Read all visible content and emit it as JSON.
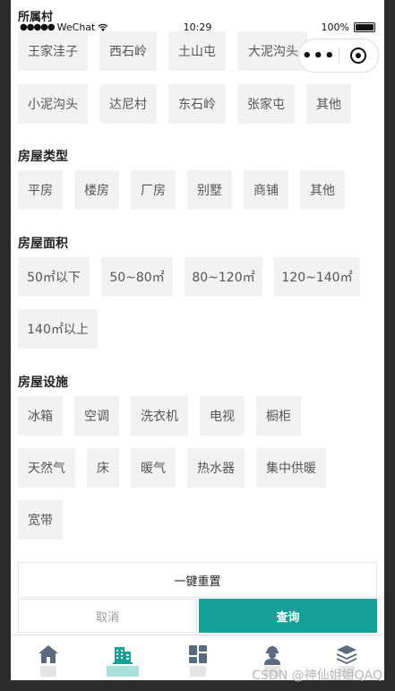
{
  "status_bar": {
    "carrier": "WeChat",
    "time": "10:29",
    "battery": "100%"
  },
  "partial_header": "所属村",
  "village_options": [
    "王家洼子",
    "西石岭",
    "土山屯",
    "大泥沟头",
    "小泥沟头",
    "达尼村",
    "东石岭",
    "张家屯",
    "其他"
  ],
  "house_type": {
    "title": "房屋类型",
    "options": [
      "平房",
      "楼房",
      "厂房",
      "别墅",
      "商铺",
      "其他"
    ]
  },
  "house_area": {
    "title": "房屋面积",
    "options": [
      "50㎡以下",
      "50~80㎡",
      "80~120㎡",
      "120~140㎡",
      "140㎡以上"
    ]
  },
  "facilities": {
    "title": "房屋设施",
    "options": [
      "冰箱",
      "空调",
      "洗衣机",
      "电视",
      "橱柜",
      "天然气",
      "床",
      "暖气",
      "热水器",
      "集中供暖",
      "宽带"
    ]
  },
  "actions": {
    "reset": "一键重置",
    "cancel": "取消",
    "query": "查询"
  },
  "colors": {
    "accent": "#14a19a",
    "chip_bg": "#f2f2f2"
  },
  "tabbar": [
    {
      "icon": "home-icon"
    },
    {
      "icon": "building-icon",
      "active": true
    },
    {
      "icon": "grid-icon"
    },
    {
      "icon": "worker-icon"
    },
    {
      "icon": "layers-icon"
    }
  ],
  "watermark": "CSDN @神仙姐姐QAQ"
}
